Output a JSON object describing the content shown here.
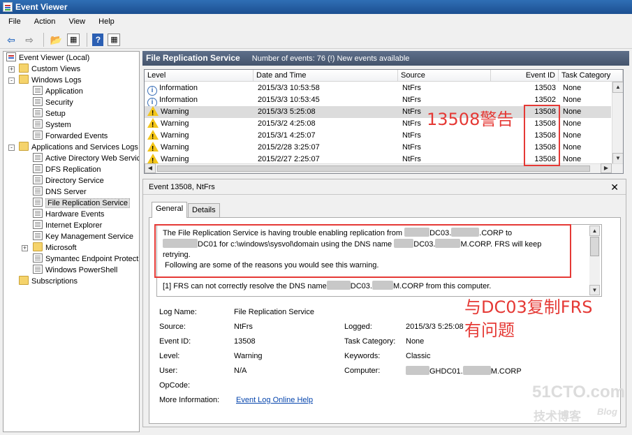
{
  "window": {
    "title": "Event Viewer"
  },
  "menu": [
    "File",
    "Action",
    "View",
    "Help"
  ],
  "toolbar": {
    "help_label": "?"
  },
  "tree": {
    "root": "Event Viewer (Local)",
    "custom_views": "Custom Views",
    "windows_logs": "Windows Logs",
    "windows_log_items": [
      "Application",
      "Security",
      "Setup",
      "System",
      "Forwarded Events"
    ],
    "apps_services": "Applications and Services Logs",
    "apps_items": [
      "Active Directory Web Servic",
      "DFS Replication",
      "Directory Service",
      "DNS Server",
      "File Replication Service",
      "Hardware Events",
      "Internet Explorer",
      "Key Management Service",
      "Microsoft",
      "Symantec Endpoint Protecti",
      "Windows PowerShell"
    ],
    "subscriptions": "Subscriptions"
  },
  "header": {
    "title": "File Replication Service",
    "count": "Number of events: 76 (!) New events available"
  },
  "table": {
    "columns": [
      "Level",
      "Date and Time",
      "Source",
      "Event ID",
      "Task Category"
    ],
    "rows": [
      {
        "level": "Information",
        "icon": "info",
        "date": "2015/3/3 10:53:58",
        "source": "NtFrs",
        "id": "13503",
        "cat": "None"
      },
      {
        "level": "Information",
        "icon": "info",
        "date": "2015/3/3 10:53:45",
        "source": "NtFrs",
        "id": "13502",
        "cat": "None"
      },
      {
        "level": "Warning",
        "icon": "warn",
        "date": "2015/3/3 5:25:08",
        "source": "NtFrs",
        "id": "13508",
        "cat": "None"
      },
      {
        "level": "Warning",
        "icon": "warn",
        "date": "2015/3/2 4:25:08",
        "source": "NtFrs",
        "id": "13508",
        "cat": "None"
      },
      {
        "level": "Warning",
        "icon": "warn",
        "date": "2015/3/1 4:25:07",
        "source": "NtFrs",
        "id": "13508",
        "cat": "None"
      },
      {
        "level": "Warning",
        "icon": "warn",
        "date": "2015/2/28 3:25:07",
        "source": "NtFrs",
        "id": "13508",
        "cat": "None"
      },
      {
        "level": "Warning",
        "icon": "warn",
        "date": "2015/2/27 2:25:07",
        "source": "NtFrs",
        "id": "13508",
        "cat": "None"
      }
    ]
  },
  "details": {
    "title": "Event 13508, NtFrs",
    "tabs": [
      "General",
      "Details"
    ],
    "desc": {
      "l1a": "The File Replication Service is having trouble enabling replication from",
      "l1b": "DC03.",
      "l1c": ".CORP to",
      "l2a": "DC01 for c:\\windows\\sysvol\\domain using the DNS name",
      "l2b": "DC03.",
      "l2c": "M.CORP. FRS will keep",
      "l3": "retrying.",
      "l4": " Following are some of the reasons you would see this warning.",
      "l5a": "[1] FRS can not correctly resolve the DNS name",
      "l5b": "DC03.",
      "l5c": "M.CORP from this computer."
    },
    "fields": {
      "log_name_label": "Log Name:",
      "log_name": "File Replication Service",
      "source_label": "Source:",
      "source": "NtFrs",
      "logged_label": "Logged:",
      "logged": "2015/3/3 5:25:08",
      "event_id_label": "Event ID:",
      "event_id": "13508",
      "task_label": "Task Category:",
      "task": "None",
      "level_label": "Level:",
      "level": "Warning",
      "keywords_label": "Keywords:",
      "keywords": "Classic",
      "user_label": "User:",
      "user": "N/A",
      "computer_label": "Computer:",
      "computer_a": "GHDC01.",
      "computer_b": "M.CORP",
      "opcode_label": "OpCode:",
      "more_info_label": "More Information:",
      "more_info_link": "Event Log Online Help"
    }
  },
  "annotations": {
    "warning_note": "13508警告",
    "frs_note_1": "与DC03复制FRS",
    "frs_note_2": "有问题",
    "accent": "#e53935"
  },
  "watermark": {
    "site": "51CTO.com",
    "sub": "技术博客",
    "blog": "Blog"
  }
}
